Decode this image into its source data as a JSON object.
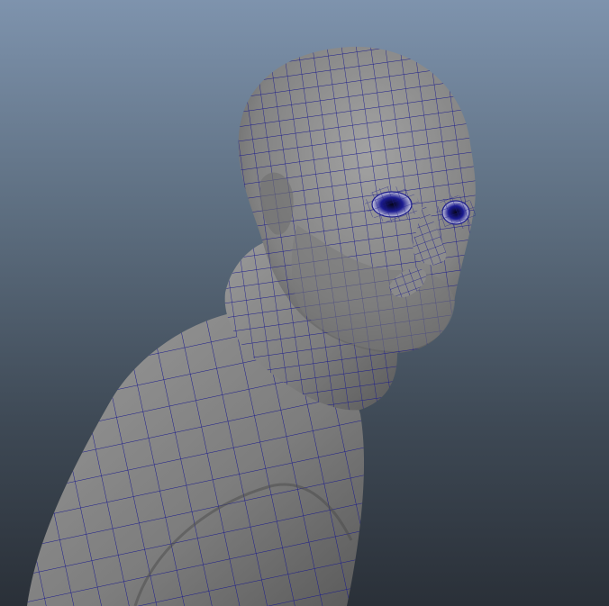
{
  "viewport": {
    "display_mode": "wireframe-on-shaded",
    "background_top": "#7e93ad",
    "background_bottom": "#2a3038",
    "surface_color": "#8a8a8a",
    "wire_color": "#1c1c8c"
  },
  "model": {
    "parts": [
      "body",
      "collar",
      "ear",
      "head",
      "eye-left",
      "eye-right",
      "nose",
      "beard",
      "mustache"
    ]
  }
}
